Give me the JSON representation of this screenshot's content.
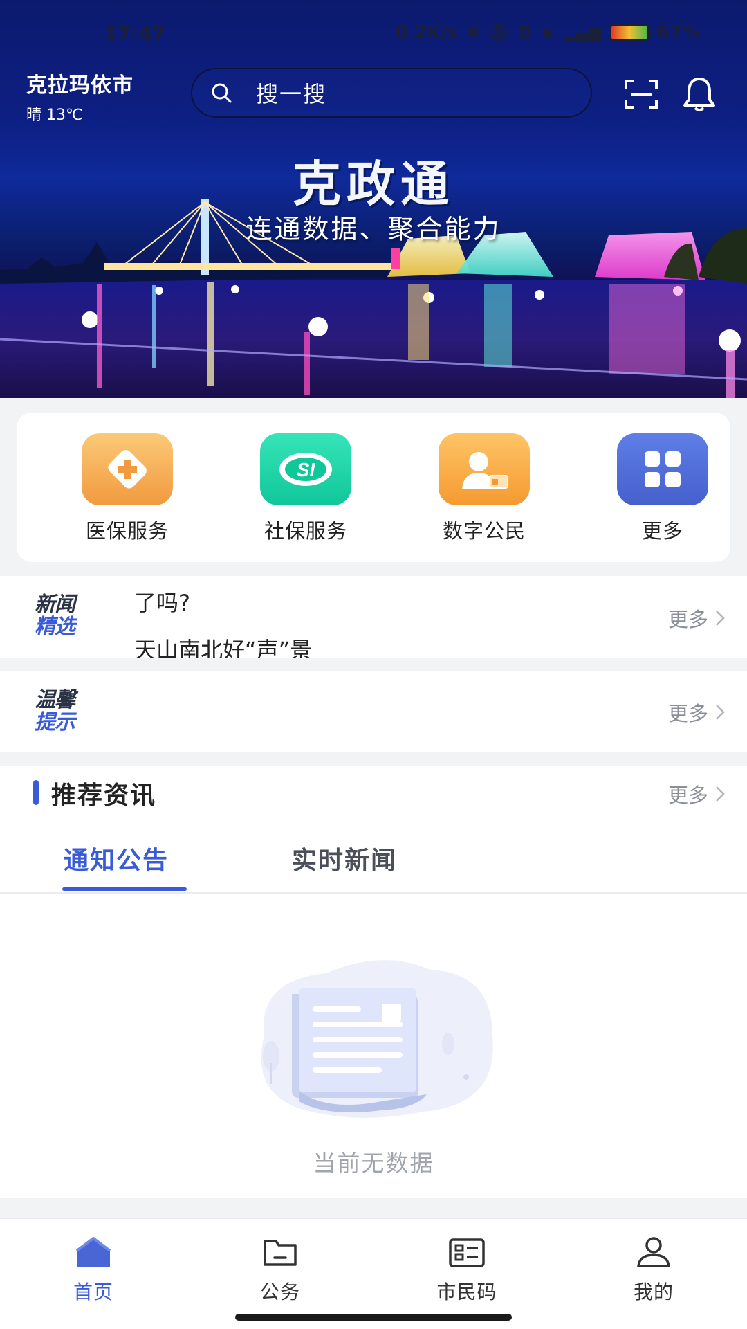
{
  "status_bar": {
    "time": "17:47",
    "net_speed": "0.2K/s",
    "battery": "67%"
  },
  "header": {
    "city": "克拉玛依市",
    "weather": "晴  13℃",
    "search_placeholder": "搜一搜",
    "scan_icon": "scan-icon",
    "bell_icon": "bell-icon"
  },
  "banner": {
    "title": "克政通",
    "subtitle": "连通数据、聚合能力"
  },
  "quick_services": [
    {
      "label": "医保服务",
      "icon": "medical-cross-icon",
      "color": "#f5a550"
    },
    {
      "label": "社保服务",
      "icon": "social-security-icon",
      "color": "#1ed6a6"
    },
    {
      "label": "数字公民",
      "icon": "citizen-id-icon",
      "color": "#f7a33e"
    },
    {
      "label": "更多",
      "icon": "grid-icon",
      "color": "#4d6bd8"
    }
  ],
  "news": {
    "tag_line1": "新闻",
    "tag_line2": "精选",
    "line1": "了吗?",
    "line2": "天山南北好“声”景",
    "more": "更多"
  },
  "tips": {
    "tag_line1": "温馨",
    "tag_line2": "提示",
    "more": "更多"
  },
  "recommend": {
    "title": "推荐资讯",
    "more": "更多",
    "tabs": [
      "通知公告",
      "实时新闻"
    ],
    "active_tab": 0,
    "empty_text": "当前无数据"
  },
  "bottom_nav": [
    {
      "label": "首页",
      "icon": "home-icon",
      "active": true
    },
    {
      "label": "公务",
      "icon": "folder-icon",
      "active": false
    },
    {
      "label": "市民码",
      "icon": "id-card-icon",
      "active": false
    },
    {
      "label": "我的",
      "icon": "user-icon",
      "active": false
    }
  ],
  "colors": {
    "accent": "#3a5bd8",
    "muted": "#8a8f99"
  }
}
